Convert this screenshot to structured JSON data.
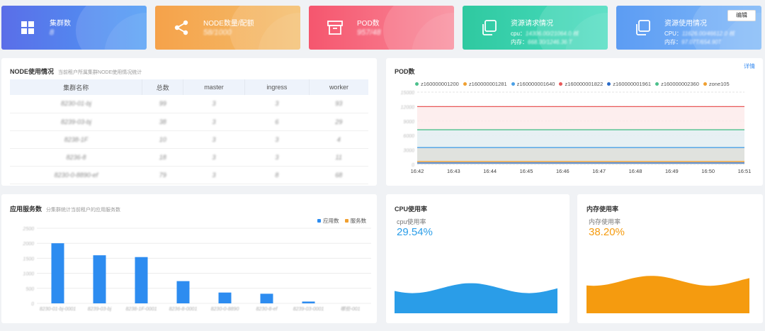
{
  "cards": [
    {
      "title": "集群数",
      "value": "8",
      "color1": "#5a6ee8",
      "color2": "#4e9cf5",
      "icon": "grid-icon"
    },
    {
      "title": "NODE数量/配额",
      "value": "58/1000",
      "color1": "#f5a24a",
      "color2": "#f4be6d",
      "icon": "share-icon"
    },
    {
      "title": "POD数",
      "value": "957/48",
      "color1": "#f5566e",
      "color2": "#f98a9a",
      "icon": "archive-icon"
    },
    {
      "title": "资源请求情况",
      "cpu_label": "cpu：",
      "cpu_value": "14306.00/21064.0 核",
      "mem_label": "内存：",
      "mem_value": "668.30/1246.36 T",
      "color1": "#2fc9a0",
      "color2": "#4adcc0",
      "icon": "copy-icon"
    },
    {
      "title": "资源使用情况",
      "cpu_label": "CPU：",
      "cpu_value": "11626.00/46612.0 核",
      "mem_label": "内存：",
      "mem_value": "97.07T/654.90T",
      "color1": "#5c9cf3",
      "color2": "#7fb8f8",
      "icon": "copy-icon"
    }
  ],
  "edit_label": "编辑",
  "node_panel": {
    "title": "NODE使用情况",
    "subtitle": "当前租户所属集群NODE使用情况统计",
    "headers": [
      "集群名称",
      "总数",
      "master",
      "ingress",
      "worker"
    ],
    "rows": [
      [
        "8230-01-bj",
        "99",
        "3",
        "3",
        "93"
      ],
      [
        "8239-03-bj",
        "38",
        "3",
        "6",
        "29"
      ],
      [
        "8238-1F",
        "10",
        "3",
        "3",
        "4"
      ],
      [
        "8236-8",
        "18",
        "3",
        "3",
        "11"
      ],
      [
        "8230-0-8890-ef",
        "79",
        "3",
        "8",
        "68"
      ]
    ]
  },
  "pod_panel": {
    "title": "POD数",
    "detail": "详情",
    "legend": [
      {
        "name": "z160000001200",
        "color": "#4cc08c"
      },
      {
        "name": "z160000001281",
        "color": "#f0a030"
      },
      {
        "name": "z160000001640",
        "color": "#4aa0e6"
      },
      {
        "name": "z160000001822",
        "color": "#e85858"
      },
      {
        "name": "z160000001961",
        "color": "#2a6bc8"
      },
      {
        "name": "z160000002360",
        "color": "#4cc08c"
      },
      {
        "name": "zone105",
        "color": "#f0a030"
      }
    ],
    "y_ticks": [
      "15000",
      "12000",
      "9000",
      "6000",
      "3000",
      "0"
    ],
    "x_ticks": [
      "16:42",
      "16:43",
      "16:44",
      "16:45",
      "16:46",
      "16:47",
      "16:48",
      "16:49",
      "16:50",
      "16:51"
    ]
  },
  "app_panel": {
    "title": "应用服务数",
    "subtitle": "分集群统计当前租户的应用服务数",
    "legend": [
      {
        "name": "应用数",
        "color": "#2d8cf0"
      },
      {
        "name": "服务数",
        "color": "#f0a030"
      }
    ],
    "y_ticks": [
      "2500",
      "2000",
      "1500",
      "1000",
      "500",
      "0"
    ],
    "x_labels": [
      "8230-01-bj-0001",
      "8239-03-bj",
      "8238-1F-0001",
      "8236-8-0001",
      "8230-0-8890",
      "8230-8-ef",
      "8239-03-0001",
      "哪些-001"
    ]
  },
  "chart_data": {
    "type": "bar",
    "categories": [
      "8230-01-bj-0001",
      "8239-03-bj",
      "8238-1F-0001",
      "8236-8-0001",
      "8230-0-8890",
      "8230-8-ef",
      "8239-03-0001",
      "哪些-001"
    ],
    "series": [
      {
        "name": "应用数",
        "values": [
          2000,
          1600,
          1540,
          740,
          360,
          320,
          60,
          0
        ]
      },
      {
        "name": "服务数",
        "values": [
          0,
          0,
          0,
          0,
          0,
          0,
          0,
          0
        ]
      }
    ],
    "ylim": [
      0,
      2500
    ]
  },
  "cpu_panel": {
    "title": "CPU使用率",
    "label": "cpu使用率",
    "value": "29.54%",
    "ratio": 0.2954,
    "color": "#2a9de8"
  },
  "mem_panel": {
    "title": "内存使用率",
    "label": "内存使用率",
    "value": "38.20%",
    "ratio": 0.382,
    "color": "#f59b0f"
  }
}
